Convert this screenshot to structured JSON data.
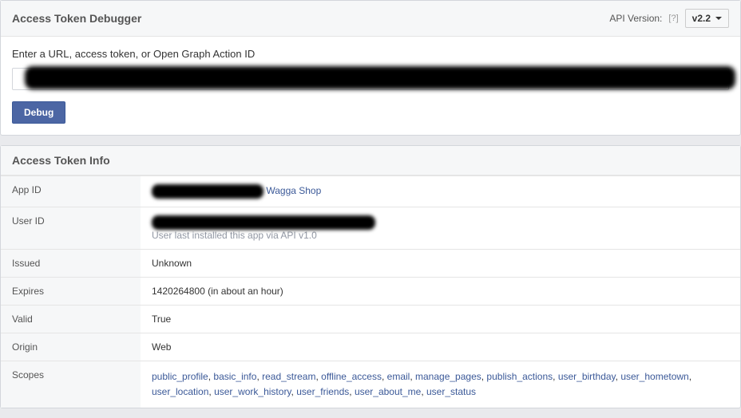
{
  "header": {
    "title": "Access Token Debugger",
    "api_version_label": "API Version:",
    "api_version_value": "v2.2"
  },
  "form": {
    "prompt": "Enter a URL, access token, or Open Graph Action ID",
    "debug_label": "Debug"
  },
  "info": {
    "header": "Access Token Info",
    "app_id": {
      "label": "App ID",
      "link_text": "Wagga Shop"
    },
    "user_id": {
      "label": "User ID",
      "subtext": "User last installed this app via API v1.0"
    },
    "issued": {
      "label": "Issued",
      "value": "Unknown"
    },
    "expires": {
      "label": "Expires",
      "value": "1420264800 (in about an hour)"
    },
    "valid": {
      "label": "Valid",
      "value": "True"
    },
    "origin": {
      "label": "Origin",
      "value": "Web"
    },
    "scopes": {
      "label": "Scopes",
      "values": [
        "public_profile",
        "basic_info",
        "read_stream",
        "offline_access",
        "email",
        "manage_pages",
        "publish_actions",
        "user_birthday",
        "user_hometown",
        "user_location",
        "user_work_history",
        "user_friends",
        "user_about_me",
        "user_status"
      ]
    }
  }
}
